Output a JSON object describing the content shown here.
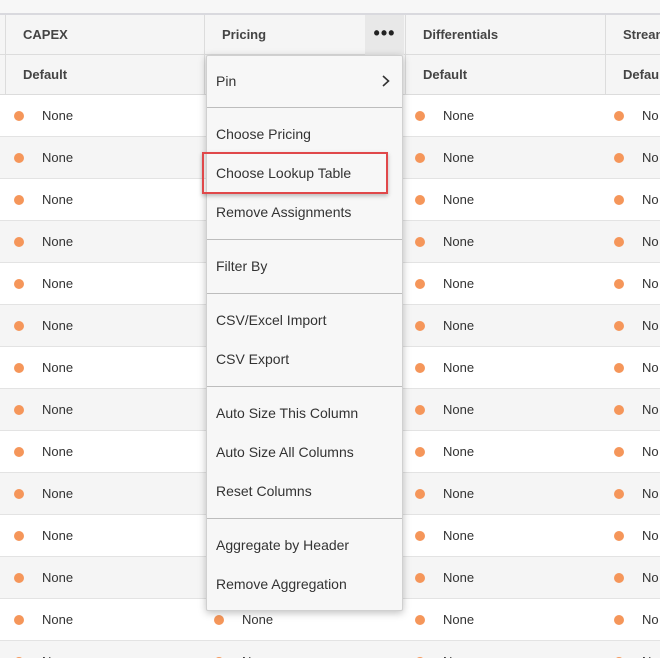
{
  "columns": {
    "headers": [
      "CAPEX",
      "Pricing",
      "Differentials",
      "Strean"
    ],
    "subheaders": [
      "Default",
      "",
      "Default",
      "Defau"
    ]
  },
  "column_menu_button": {
    "glyph": "•••"
  },
  "rows": [
    [
      "None",
      "",
      "None",
      "No"
    ],
    [
      "None",
      "",
      "None",
      "No"
    ],
    [
      "None",
      "",
      "None",
      "No"
    ],
    [
      "None",
      "",
      "None",
      "No"
    ],
    [
      "None",
      "",
      "None",
      "No"
    ],
    [
      "None",
      "",
      "None",
      "No"
    ],
    [
      "None",
      "",
      "None",
      "No"
    ],
    [
      "None",
      "",
      "None",
      "No"
    ],
    [
      "None",
      "",
      "None",
      "No"
    ],
    [
      "None",
      "",
      "None",
      "No"
    ],
    [
      "None",
      "",
      "None",
      "No"
    ],
    [
      "None",
      "",
      "None",
      "No"
    ],
    [
      "None",
      "None",
      "None",
      "No"
    ],
    [
      "None",
      "None",
      "None",
      "No"
    ]
  ],
  "context_menu": {
    "pin": "Pin",
    "choose_pricing": "Choose Pricing",
    "choose_lookup_table": "Choose Lookup Table",
    "remove_assignments": "Remove Assignments",
    "filter_by": "Filter By",
    "csv_excel_import": "CSV/Excel Import",
    "csv_export": "CSV Export",
    "auto_size_this_column": "Auto Size This Column",
    "auto_size_all_columns": "Auto Size All Columns",
    "reset_columns": "Reset Columns",
    "aggregate_by_header": "Aggregate by Header",
    "remove_aggregation": "Remove Aggregation"
  },
  "colors": {
    "status_dot": "#f5965a",
    "highlight_border": "#e0484a"
  },
  "icons": {
    "status": "dot-icon",
    "submenu": "chevron-right-icon"
  }
}
